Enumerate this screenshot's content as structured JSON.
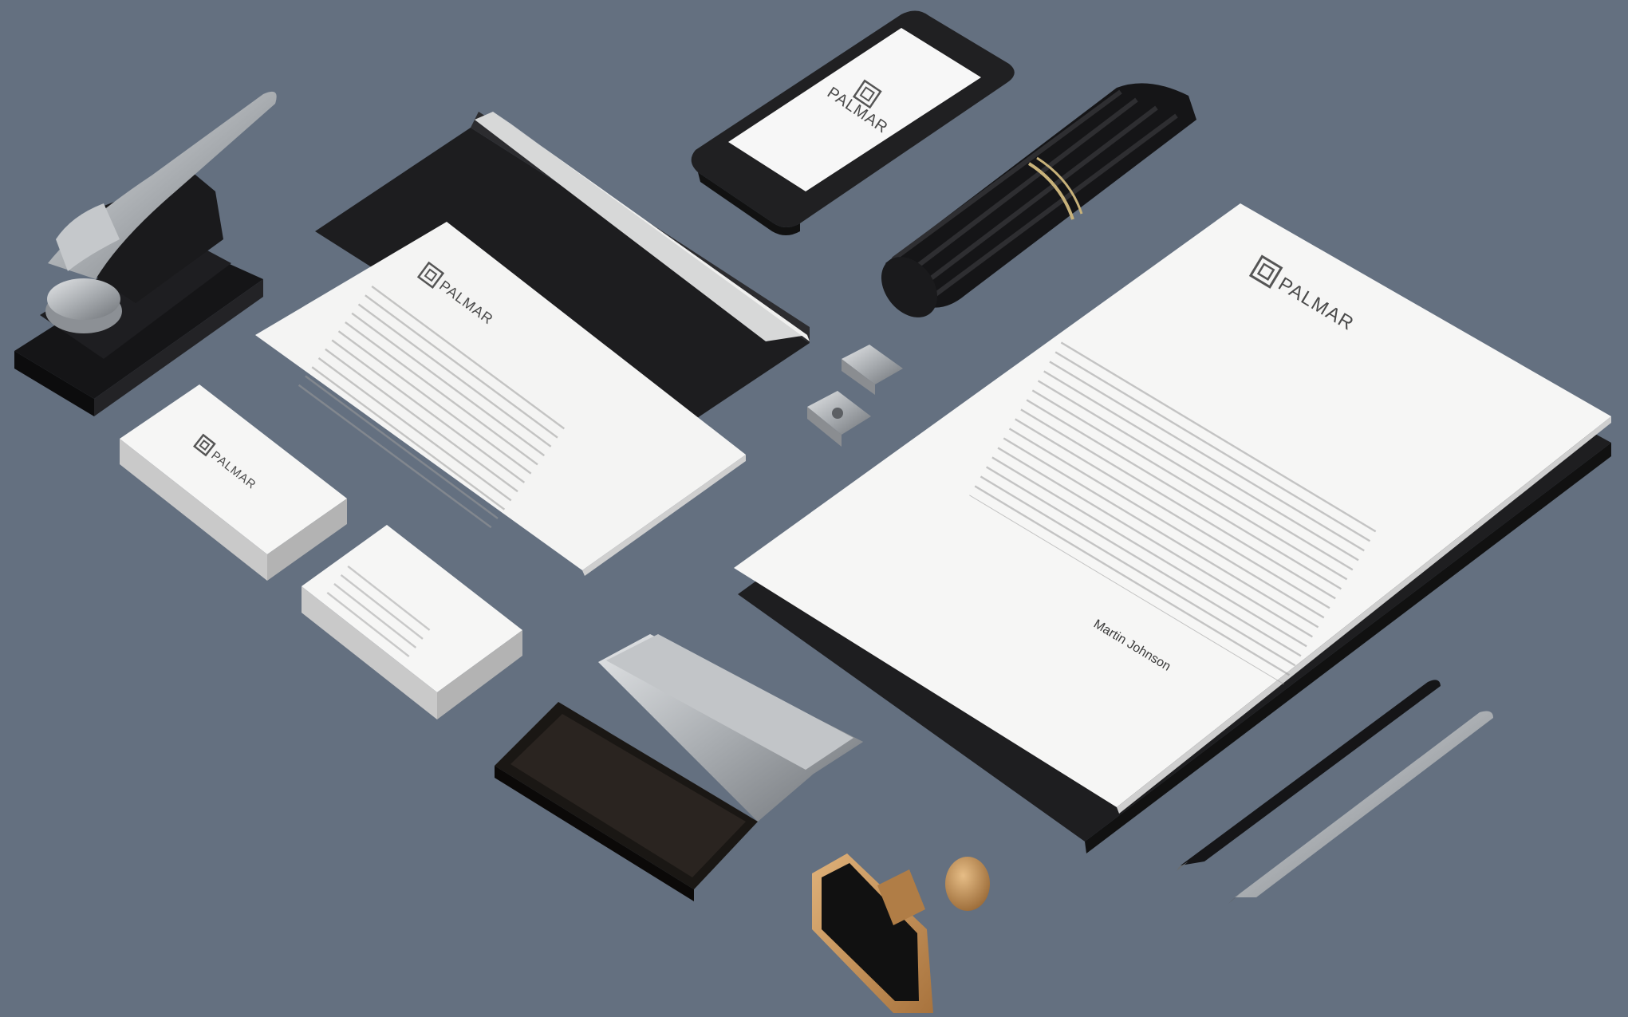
{
  "scene": {
    "description_tags": [
      "stationery-mockup",
      "brand-identity"
    ],
    "colors": {
      "background": "#647080",
      "paper": "#f4f4f3",
      "black": "#1d1d1f",
      "metal": "#b9bcbf",
      "wood": "#c8955a"
    }
  },
  "brand": {
    "name": "PALMAR",
    "logo_icon": "square-p-monogram-icon"
  },
  "letterhead": {
    "signature": "Martin Johnson"
  }
}
